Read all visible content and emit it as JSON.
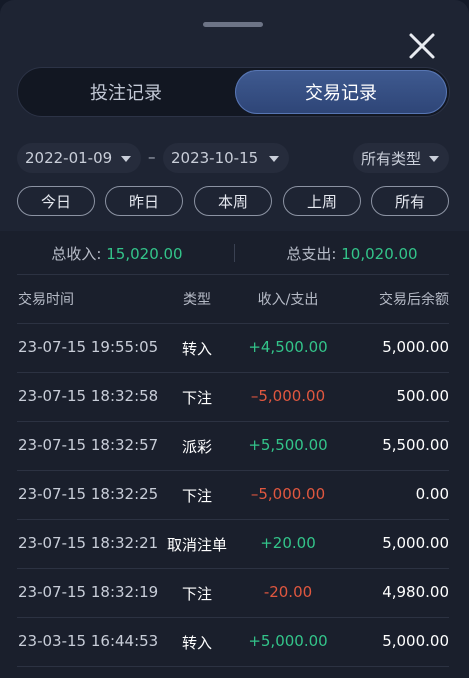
{
  "tabs": [
    {
      "label": "投注记录",
      "active": false
    },
    {
      "label": "交易记录",
      "active": true
    }
  ],
  "filters": {
    "start_date": "2022-01-09",
    "separator": "–",
    "end_date": "2023-10-15",
    "type_select": "所有类型"
  },
  "quick_ranges": [
    "今日",
    "昨日",
    "本周",
    "上周",
    "所有"
  ],
  "summary": {
    "income_label": "总收入:",
    "income_value": "15,020.00",
    "expense_label": "总支出:",
    "expense_value": "10,020.00"
  },
  "table": {
    "headers": [
      "交易时间",
      "类型",
      "收入/支出",
      "交易后余额"
    ],
    "rows": [
      {
        "time": "23-07-15 19:55:05",
        "type": "转入",
        "amount": "+4,500.00",
        "sign": "pos",
        "balance": "5,000.00"
      },
      {
        "time": "23-07-15 18:32:58",
        "type": "下注",
        "amount": "–5,000.00",
        "sign": "neg",
        "balance": "500.00"
      },
      {
        "time": "23-07-15 18:32:57",
        "type": "派彩",
        "amount": "+5,500.00",
        "sign": "pos",
        "balance": "5,500.00"
      },
      {
        "time": "23-07-15 18:32:25",
        "type": "下注",
        "amount": "–5,000.00",
        "sign": "neg",
        "balance": "0.00"
      },
      {
        "time": "23-07-15 18:32:21",
        "type": "取消注单",
        "amount": "+20.00",
        "sign": "pos",
        "balance": "5,000.00"
      },
      {
        "time": "23-07-15 18:32:19",
        "type": "下注",
        "amount": "-20.00",
        "sign": "neg",
        "balance": "4,980.00"
      },
      {
        "time": "23-03-15 16:44:53",
        "type": "转入",
        "amount": "+5,000.00",
        "sign": "pos",
        "balance": "5,000.00"
      }
    ]
  },
  "colors": {
    "accent": "#3f5a90",
    "positive": "#33c48a",
    "negative": "#e0573f"
  },
  "icons": {
    "close": "close-icon",
    "dropdown": "chevron-down-icon"
  }
}
